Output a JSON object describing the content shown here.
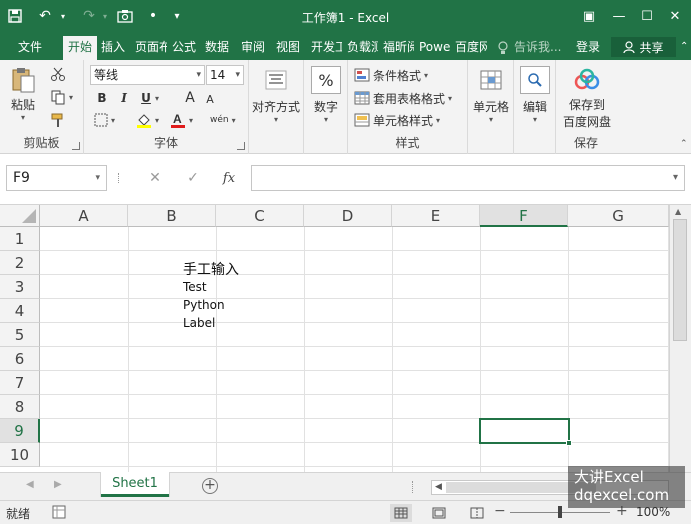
{
  "window": {
    "title": "工作簿1 - Excel",
    "qat": {
      "save_icon": "save-icon",
      "undo_icon": "undo-icon",
      "redo_icon": "redo-icon",
      "camera_icon": "camera-icon",
      "dot": "•",
      "customize": "▾"
    },
    "controls": {
      "ribbon_display": "▣",
      "minimize": "—",
      "maximize": "☐",
      "close": "✕"
    }
  },
  "tabs": [
    {
      "label": "文件"
    },
    {
      "label": "开始"
    },
    {
      "label": "插入"
    },
    {
      "label": "页面布"
    },
    {
      "label": "公式"
    },
    {
      "label": "数据"
    },
    {
      "label": "审阅"
    },
    {
      "label": "视图"
    },
    {
      "label": "开发工"
    },
    {
      "label": "负载测"
    },
    {
      "label": "福昕阅"
    },
    {
      "label": "Powe"
    },
    {
      "label": "百度网"
    }
  ],
  "tell_me": "告诉我...",
  "signin": "登录",
  "share": "共享",
  "ribbon": {
    "clipboard": {
      "paste": "粘贴",
      "label": "剪贴板"
    },
    "font": {
      "name": "等线",
      "size": "14",
      "bold": "B",
      "italic": "I",
      "underline": "U",
      "grow": "A",
      "shrink": "A",
      "wen": "wén",
      "label": "字体"
    },
    "align": {
      "label": "对齐方式"
    },
    "number": {
      "symbol": "%",
      "label": "数字"
    },
    "styles": {
      "conditional": "条件格式",
      "table": "套用表格格式",
      "cell": "单元格样式",
      "label": "样式"
    },
    "cells": {
      "label": "单元格"
    },
    "editing": {
      "label": "编辑"
    },
    "save": {
      "line1": "保存到",
      "line2": "百度网盘",
      "label": "保存"
    }
  },
  "formula_bar": {
    "name_box": "F9",
    "cancel": "✕",
    "enter": "✓",
    "fx": "fx",
    "value": ""
  },
  "columns": [
    "A",
    "B",
    "C",
    "D",
    "E",
    "F",
    "G"
  ],
  "rows": [
    "1",
    "2",
    "3",
    "4",
    "5",
    "6",
    "7",
    "8",
    "9",
    "10"
  ],
  "selected": {
    "column": "F",
    "row": "9"
  },
  "cells": {
    "B2": "手工输入",
    "B3": "Test",
    "B4": "Python",
    "B5": "Label"
  },
  "sheets": [
    {
      "name": "Sheet1"
    }
  ],
  "add_sheet": "+",
  "status": {
    "ready": "就绪",
    "zoom": "100%",
    "minus": "−",
    "plus": "+"
  },
  "watermark": {
    "line1": "大讲Excel",
    "line2": "dqexcel.com"
  }
}
